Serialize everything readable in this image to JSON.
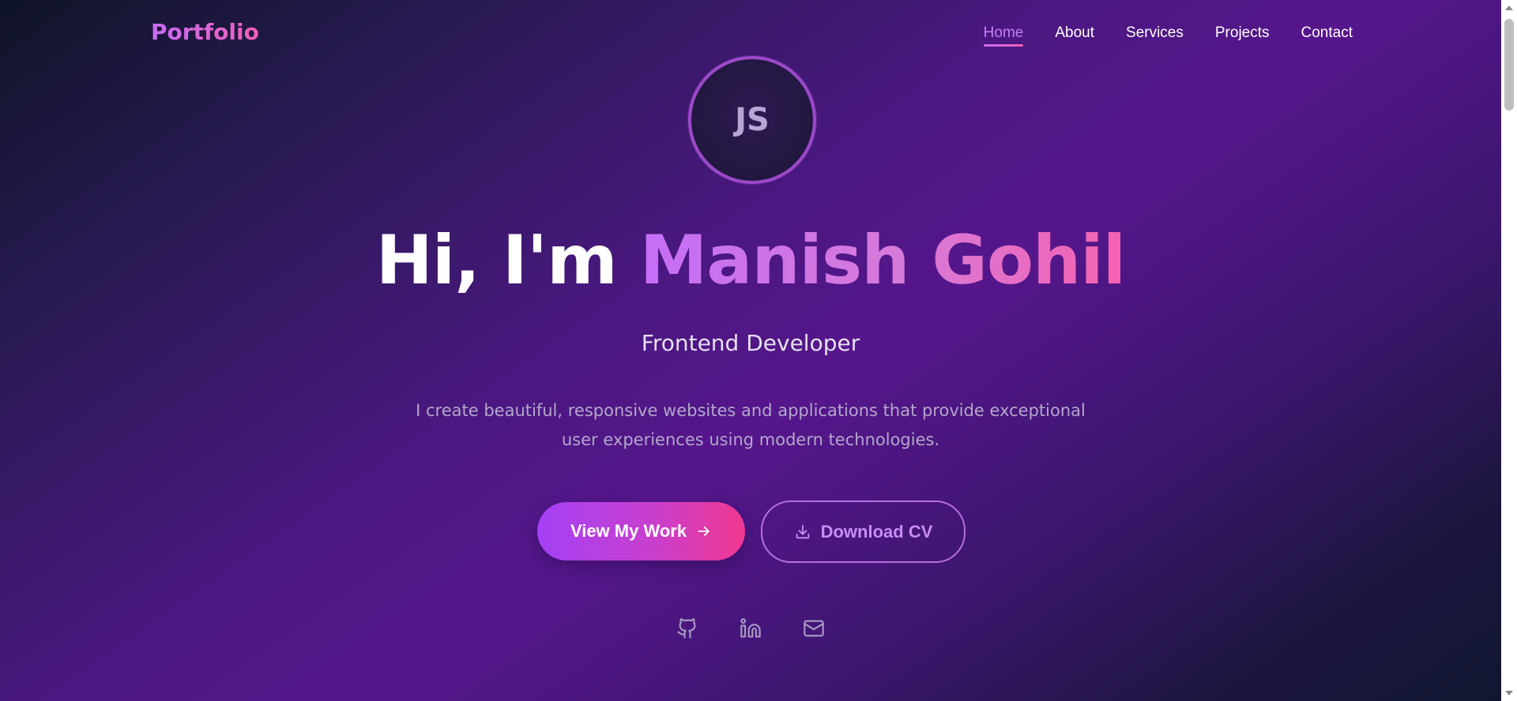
{
  "nav": {
    "logo": "Portfolio",
    "links": [
      {
        "label": "Home",
        "active": true
      },
      {
        "label": "About"
      },
      {
        "label": "Services"
      },
      {
        "label": "Projects"
      },
      {
        "label": "Contact"
      }
    ]
  },
  "hero": {
    "avatar_initials": "JS",
    "greeting": "Hi, I'm ",
    "name": "Manish Gohil",
    "role": "Frontend Developer",
    "description": "I create beautiful, responsive websites and applications that provide exceptional user experiences using modern technologies.",
    "primary_button": {
      "label": "View My Work",
      "icon": "arrow-right-icon"
    },
    "secondary_button": {
      "label": "Download CV",
      "icon": "download-icon"
    },
    "socials": [
      {
        "name": "github",
        "icon": "github-icon"
      },
      {
        "name": "linkedin",
        "icon": "linkedin-icon"
      },
      {
        "name": "email",
        "icon": "mail-icon"
      }
    ]
  },
  "colors": {
    "accent_purple": "#c66cf7",
    "accent_pink": "#f25fb4",
    "background_mid": "#56168c"
  }
}
